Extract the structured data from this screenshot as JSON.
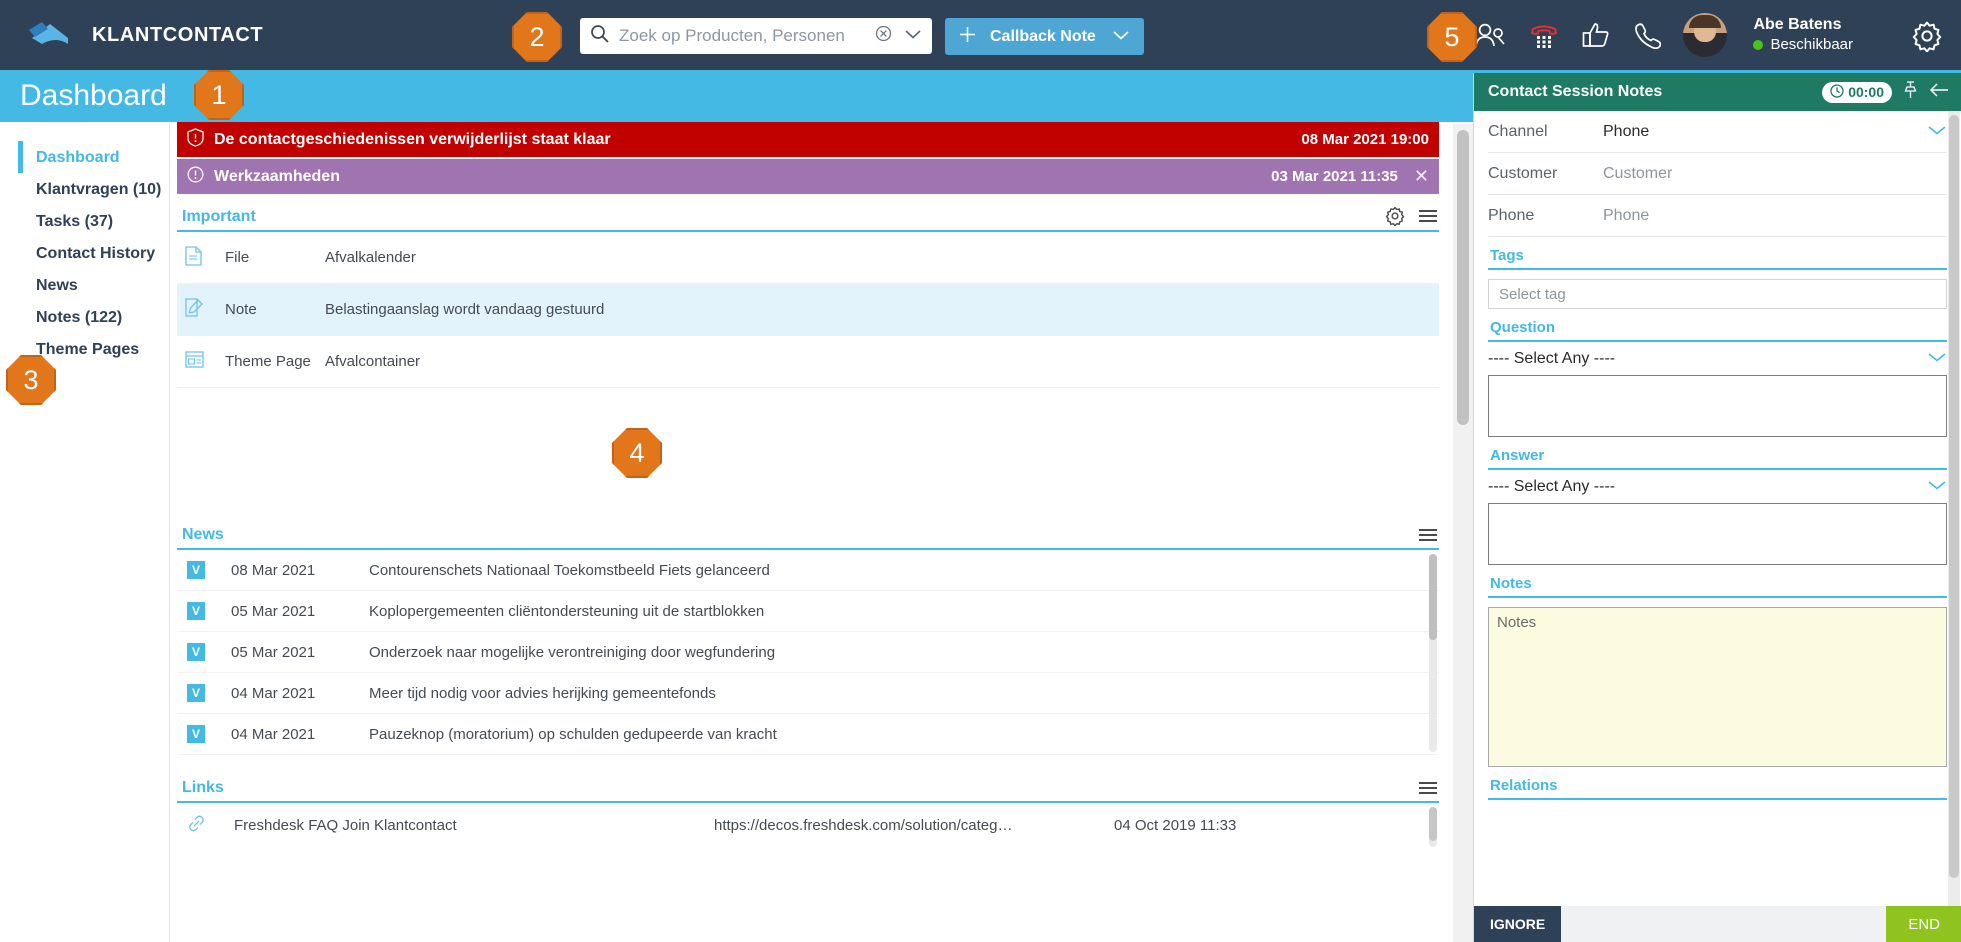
{
  "app": {
    "brand": "KLANTCONTACT",
    "logo_icon": "decos-logo-icon"
  },
  "search": {
    "placeholder": "Zoek op Producten, Personen",
    "value": "",
    "icon": "search-icon",
    "clear_icon": "clear-circle-icon",
    "dropdown_icon": "chevron-down-icon"
  },
  "callback": {
    "label": "Callback Note",
    "plus_icon": "plus-icon",
    "chevron_icon": "chevron-down-icon"
  },
  "top_icons": [
    {
      "name": "contacts-icon",
      "glyph": "contacts"
    },
    {
      "name": "dialpad-icon",
      "glyph": "dialpad"
    },
    {
      "name": "thumbs-up-icon",
      "glyph": "thumbsup"
    },
    {
      "name": "phone-icon",
      "glyph": "phone"
    }
  ],
  "user": {
    "name": "Abe Batens",
    "status": "Beschikbaar",
    "status_color": "#4cc417",
    "avatar_icon": "user-avatar"
  },
  "settings_icon": "gear-icon",
  "page": {
    "title": "Dashboard"
  },
  "sidebar": {
    "items": [
      {
        "label": "Dashboard",
        "active": true
      },
      {
        "label": "Klantvragen (10)",
        "active": false
      },
      {
        "label": "Tasks (37)",
        "active": false
      },
      {
        "label": "Contact History",
        "active": false
      },
      {
        "label": "News",
        "active": false
      },
      {
        "label": "Notes (122)",
        "active": false
      },
      {
        "label": "Theme Pages",
        "active": false
      }
    ]
  },
  "alerts": [
    {
      "icon": "shield-alert-icon",
      "text": "De contactgeschiedenissen verwijderlijst staat klaar",
      "time": "08 Mar 2021 19:00",
      "color": "#c10000",
      "closable": false
    },
    {
      "icon": "exclamation-circle-icon",
      "text": "Werkzaamheden",
      "time": "03 Mar 2021 11:35",
      "color": "#a074b0",
      "closable": true,
      "close_label": "✕"
    }
  ],
  "important": {
    "title": "Important",
    "gear_icon": "gear-icon",
    "menu_icon": "hamburger-menu-icon",
    "rows": [
      {
        "icon": "file-icon",
        "type": "File",
        "title": "Afvalkalender",
        "highlight": false
      },
      {
        "icon": "note-edit-icon",
        "type": "Note",
        "title": "Belastingaanslag wordt vandaag gestuurd",
        "highlight": true
      },
      {
        "icon": "theme-page-icon",
        "type": "Theme Page",
        "title": "Afvalcontainer",
        "highlight": false
      }
    ]
  },
  "news": {
    "title": "News",
    "menu_icon": "hamburger-menu-icon",
    "badge_letter": "V",
    "rows": [
      {
        "date": "08 Mar 2021",
        "title": "Contourenschets Nationaal Toekomstbeeld Fiets gelanceerd"
      },
      {
        "date": "05 Mar 2021",
        "title": "Koplopergemeenten cliëntondersteuning uit de startblokken"
      },
      {
        "date": "05 Mar 2021",
        "title": "Onderzoek naar mogelijke verontreiniging door wegfundering"
      },
      {
        "date": "04 Mar 2021",
        "title": "Meer tijd nodig voor advies herijking gemeentefonds"
      },
      {
        "date": "04 Mar 2021",
        "title": "Pauzeknop (moratorium) op schulden gedupeerde van kracht"
      }
    ]
  },
  "links": {
    "title": "Links",
    "menu_icon": "hamburger-menu-icon",
    "rows": [
      {
        "icon": "link-chain-icon",
        "name": "Freshdesk FAQ Join Klantcontact",
        "url": "https://decos.freshdesk.com/solution/categ…",
        "date": "04 Oct 2019 11:33"
      }
    ]
  },
  "right_panel": {
    "title": "Contact Session Notes",
    "timer": "00:00",
    "timer_icon": "clock-icon",
    "pin_icon": "pin-icon",
    "collapse_icon": "arrow-left-icon",
    "fields": [
      {
        "label": "Channel",
        "value": "Phone",
        "muted": false,
        "has_chevron": true
      },
      {
        "label": "Customer",
        "value": "Customer",
        "muted": true,
        "has_chevron": false
      },
      {
        "label": "Phone",
        "value": "Phone",
        "muted": true,
        "has_chevron": false
      }
    ],
    "tags": {
      "heading": "Tags",
      "placeholder": "Select tag",
      "value": ""
    },
    "question": {
      "heading": "Question",
      "selected": "---- Select Any ----",
      "text": ""
    },
    "answer": {
      "heading": "Answer",
      "selected": "---- Select Any ----",
      "text": ""
    },
    "notes": {
      "heading": "Notes",
      "placeholder": "Notes",
      "value": ""
    },
    "relations": {
      "heading": "Relations"
    },
    "footer": {
      "ignore_label": "IGNORE",
      "end_label": "END"
    }
  },
  "callouts": [
    {
      "number": "1"
    },
    {
      "number": "2"
    },
    {
      "number": "3"
    },
    {
      "number": "4"
    },
    {
      "number": "5"
    }
  ]
}
